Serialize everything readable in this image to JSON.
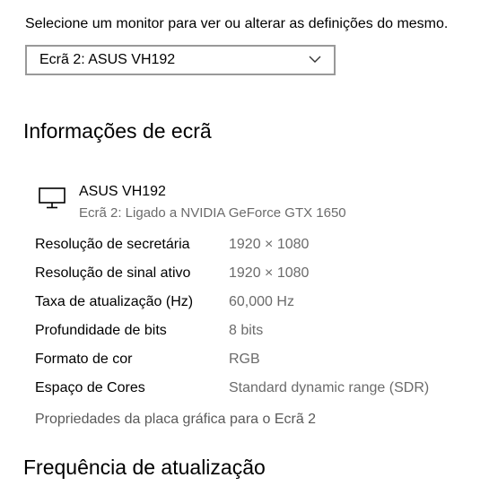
{
  "header": {
    "prompt": "Selecione um monitor para ver ou alterar as definições do mesmo."
  },
  "monitor_select": {
    "selected": "Ecrã 2: ASUS VH192",
    "icon": "chevron-down-icon"
  },
  "display_info": {
    "title": "Informações de ecrã",
    "icon": "monitor-icon",
    "display_name": "ASUS VH192",
    "display_sub": "Ecrã 2: Ligado a NVIDIA GeForce GTX 1650",
    "properties": [
      {
        "label": "Resolução de secretária",
        "value": "1920 × 1080"
      },
      {
        "label": "Resolução de sinal ativo",
        "value": "1920 × 1080"
      },
      {
        "label": "Taxa de atualização (Hz)",
        "value": "60,000 Hz"
      },
      {
        "label": "Profundidade de bits",
        "value": "8 bits"
      },
      {
        "label": "Formato de cor",
        "value": "RGB"
      },
      {
        "label": "Espaço de Cores",
        "value": "Standard dynamic range (SDR)"
      }
    ],
    "adapter_link": "Propriedades da placa gráfica para o Ecrã 2"
  },
  "refresh": {
    "title": "Frequência de atualização"
  }
}
